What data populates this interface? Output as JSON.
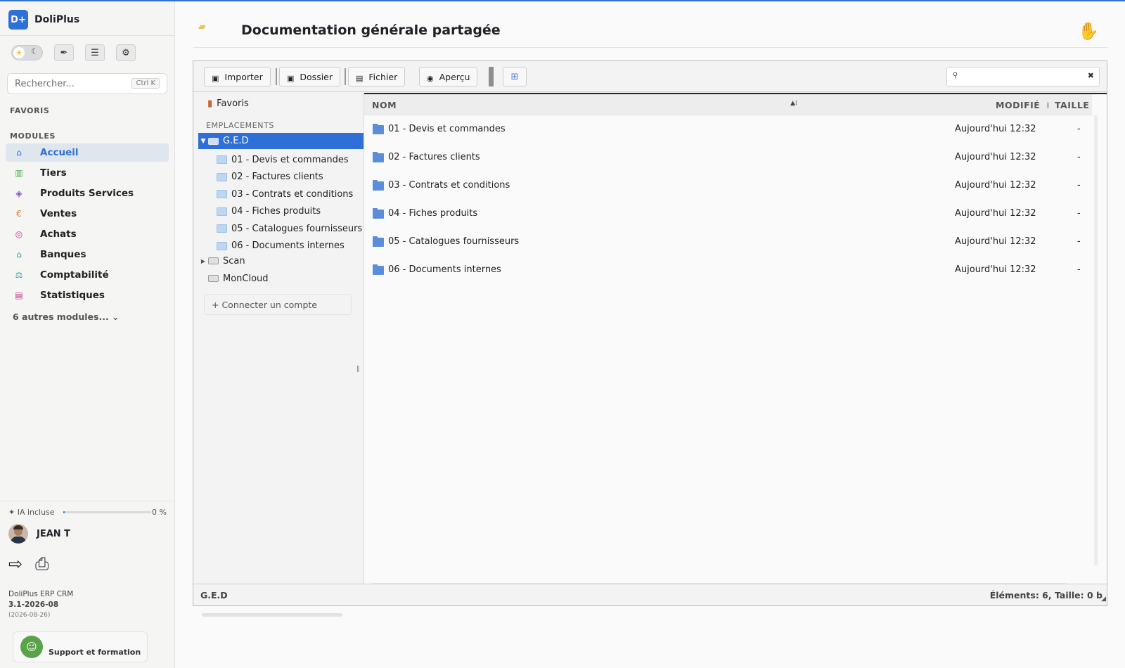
{
  "app": {
    "logo": "D+",
    "name": "DoliPlus"
  },
  "sidebar": {
    "tools": [
      "pen-icon",
      "list-icon",
      "gear-icon"
    ],
    "search": {
      "placeholder": "Rechercher...",
      "shortcut": "Ctrl K"
    },
    "favorites_title": "FAVORIS",
    "modules_title": "MODULES",
    "items": [
      {
        "label": "Accueil",
        "icon": "home-icon",
        "color": "#2f6fd8",
        "active": true
      },
      {
        "label": "Tiers",
        "icon": "building-icon",
        "color": "#4caf50"
      },
      {
        "label": "Produits Services",
        "icon": "cubes-icon",
        "color": "#7a4ecf"
      },
      {
        "label": "Ventes",
        "icon": "euro-icon",
        "color": "#e07b2c"
      },
      {
        "label": "Achats",
        "icon": "coins-icon",
        "color": "#c2338f"
      },
      {
        "label": "Banques",
        "icon": "bank-icon",
        "color": "#2a9bb0"
      },
      {
        "label": "Comptabilité",
        "icon": "scale-icon",
        "color": "#2a9bb0"
      },
      {
        "label": "Statistiques",
        "icon": "chart-icon",
        "color": "#c2338f"
      }
    ],
    "more_modules": "6 autres modules... ⌄",
    "ia": {
      "label": "✦ IA incluse",
      "percent_text": "0 %",
      "progress": 0.02
    },
    "user_name": "JEAN T",
    "version": {
      "product": "DoliPlus ERP CRM",
      "number": "3.1-2026-08",
      "date": "(2026-08-26)"
    },
    "support_label": "Support et formation"
  },
  "page": {
    "title": "Documentation générale partagée"
  },
  "toolbar": {
    "import": "Importer",
    "folder": "Dossier",
    "file": "Fichier",
    "preview": "Aperçu"
  },
  "tree": {
    "favorites": "Favoris",
    "locations_title": "EMPLACEMENTS",
    "root": "G.E.D",
    "children": [
      "01 - Devis et commandes",
      "02 - Factures clients",
      "03 - Contrats et conditions",
      "04 - Fiches produits",
      "05 - Catalogues fournisseurs",
      "06 - Documents internes"
    ],
    "others": [
      "Scan",
      "MonCloud"
    ],
    "connect": "+ Connecter un compte"
  },
  "list": {
    "columns": {
      "name": "NOM",
      "modified": "MODIFIÉ",
      "size": "TAILLE"
    },
    "rows": [
      {
        "name": "01 - Devis et commandes",
        "modified": "Aujourd'hui 12:32",
        "size": "-"
      },
      {
        "name": "02 - Factures clients",
        "modified": "Aujourd'hui 12:32",
        "size": "-"
      },
      {
        "name": "03 - Contrats et conditions",
        "modified": "Aujourd'hui 12:32",
        "size": "-"
      },
      {
        "name": "04 - Fiches produits",
        "modified": "Aujourd'hui 12:32",
        "size": "-"
      },
      {
        "name": "05 - Catalogues fournisseurs",
        "modified": "Aujourd'hui 12:32",
        "size": "-"
      },
      {
        "name": "06 - Documents internes",
        "modified": "Aujourd'hui 12:32",
        "size": "-"
      }
    ]
  },
  "status": {
    "path": "G.E.D",
    "summary": "Éléments: 6, Taille: 0 b"
  }
}
